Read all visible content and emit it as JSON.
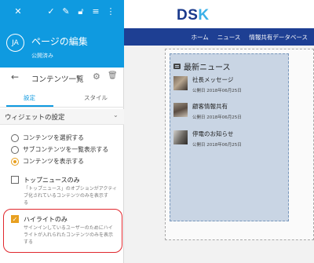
{
  "panel": {
    "toolbar": {
      "close_icon": "✕",
      "check_icon": "✓",
      "edit_icon": "✎",
      "lock_icon": "🔓︎",
      "list_icon": "≡",
      "more_icon": "⋮"
    },
    "avatar_initials": "JA",
    "title": "ページの編集",
    "subtitle": "公開済み",
    "breadcrumb": {
      "back_icon": "←",
      "title": "コンテンツ一覧",
      "settings_icon": "⚙",
      "trash_icon": "🗑︎"
    },
    "tabs": [
      {
        "label": "設定",
        "active": true
      },
      {
        "label": "スタイル",
        "active": false
      }
    ],
    "section": {
      "label": "ウィジェットの設定",
      "chevron": "⌄"
    },
    "radios": [
      {
        "label": "コンテンツを選択する",
        "selected": false
      },
      {
        "label": "サブコンテンツを一覧表示する",
        "selected": false
      },
      {
        "label": "コンテンツを表示する",
        "selected": true
      }
    ],
    "top_news": {
      "label": "トップニュースのみ",
      "checked": false,
      "desc_line1": "「トップニュース」のオプションがアクティ",
      "desc_line2": "ブ化されているコンテンツのみを表示す",
      "desc_line3": "る"
    },
    "highlight_only": {
      "label": "ハイライトのみ",
      "checked": true,
      "check_mark": "✓",
      "desc_line1": "サインインしているユーザーのためにハイ",
      "desc_line2": "ライトが入れられたコンテンツのみを表示",
      "desc_line3": "する"
    }
  },
  "site": {
    "logo_main": "DS",
    "logo_accent": "K",
    "nav": [
      "ホーム",
      "ニュース",
      "情報共有データベース"
    ]
  },
  "widget": {
    "title": "最新ニュース",
    "items": [
      {
        "title": "社長メッセージ",
        "date": "公開日 2018年06月25日"
      },
      {
        "title": "顧客情報共有",
        "date": "公開日 2018年06月25日"
      },
      {
        "title": "停電のお知らせ",
        "date": "公開日 2018年06月25日"
      }
    ]
  },
  "colors": {
    "panel_header": "#0f9ae0",
    "nav_bar": "#1e3f93",
    "accent_orange": "#e8a020",
    "highlight_ring": "#e0282e",
    "widget_bg": "#c9d5e4"
  }
}
